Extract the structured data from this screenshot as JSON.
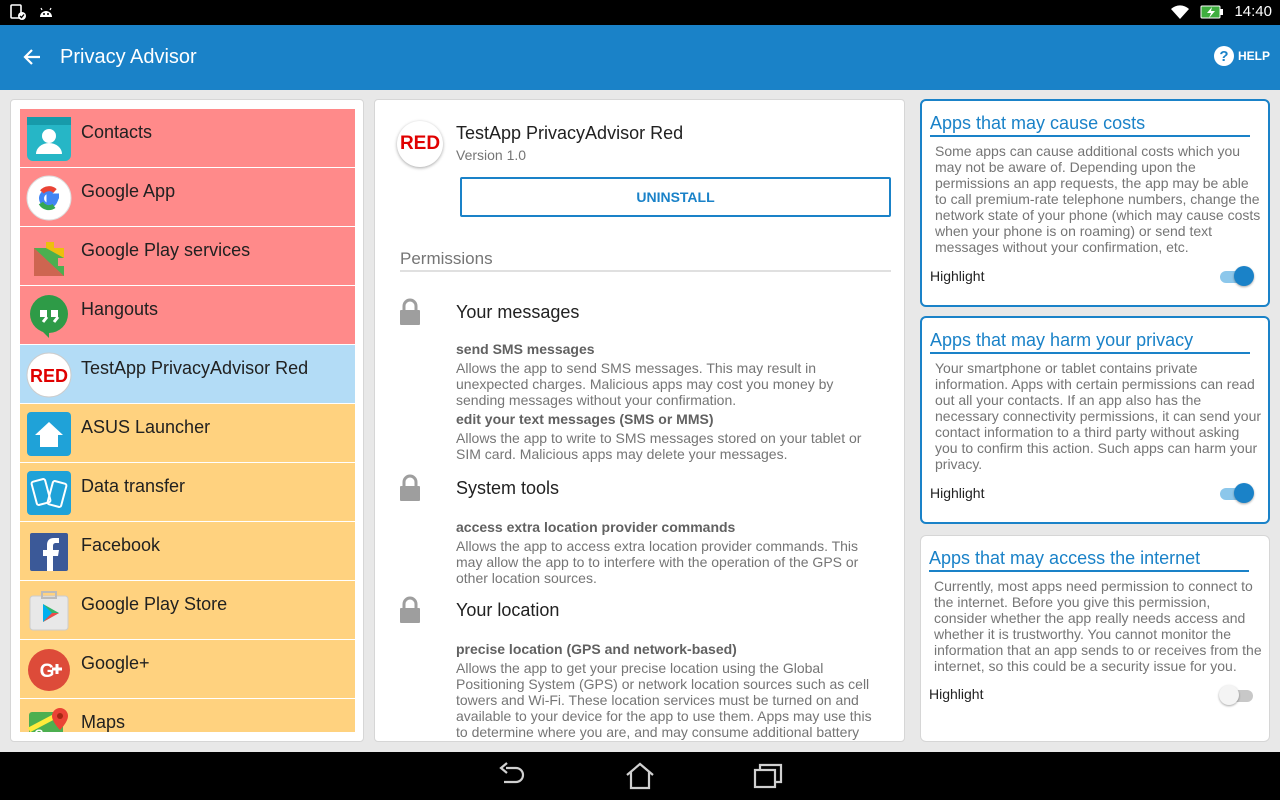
{
  "status_bar": {
    "time": "14:40"
  },
  "app_bar": {
    "title": "Privacy Advisor",
    "help_label": "HELP"
  },
  "apps": [
    {
      "name": "Contacts",
      "bg": "#ff8a8a",
      "icon": "contacts-icon"
    },
    {
      "name": "Google App",
      "bg": "#ff8a8a",
      "icon": "google-app-icon"
    },
    {
      "name": "Google Play services",
      "bg": "#ff8a8a",
      "icon": "google-play-services-icon"
    },
    {
      "name": "Hangouts",
      "bg": "#ff8a8a",
      "icon": "hangouts-icon"
    },
    {
      "name": "TestApp PrivacyAdvisor Red",
      "bg": "#b3dcf6",
      "icon": "red-badge-icon",
      "badge": "RED"
    },
    {
      "name": "ASUS Launcher",
      "bg": "#ffd27f",
      "icon": "asus-launcher-icon"
    },
    {
      "name": "Data transfer",
      "bg": "#ffd27f",
      "icon": "data-transfer-icon"
    },
    {
      "name": "Facebook",
      "bg": "#ffd27f",
      "icon": "facebook-icon"
    },
    {
      "name": "Google Play Store",
      "bg": "#ffd27f",
      "icon": "google-play-store-icon"
    },
    {
      "name": "Google+",
      "bg": "#ffd27f",
      "icon": "google-plus-icon"
    },
    {
      "name": "Maps",
      "bg": "#ffd27f",
      "icon": "maps-icon"
    }
  ],
  "detail": {
    "badge": "RED",
    "app_name": "TestApp PrivacyAdvisor Red",
    "version": "Version 1.0",
    "uninstall_label": "UNINSTALL",
    "permissions_header": "Permissions",
    "groups": [
      {
        "title": "Your messages",
        "perms": [
          {
            "name": "send SMS messages",
            "desc": "Allows the app to send SMS messages. This may result in unexpected charges. Malicious apps may cost you money by sending messages without your confirmation."
          },
          {
            "name": "edit your text messages (SMS or MMS)",
            "desc": "Allows the app to write to SMS messages stored on your tablet or SIM card. Malicious apps may delete your messages."
          }
        ]
      },
      {
        "title": "System tools",
        "perms": [
          {
            "name": "access extra location provider commands",
            "desc": "Allows the app to access extra location provider commands. This may allow the app to to interfere with the operation of the GPS or other location sources."
          }
        ]
      },
      {
        "title": "Your location",
        "perms": [
          {
            "name": "precise location (GPS and network-based)",
            "desc": "Allows the app to get your precise location using the Global Positioning System (GPS) or network location sources such as cell towers and Wi-Fi. These location services must be turned on and available to your device for the app to use them. Apps may use this to determine where you are, and may consume additional battery"
          }
        ]
      }
    ]
  },
  "cards": [
    {
      "title": "Apps that may cause costs",
      "body": "Some apps can cause additional costs which you may not be aware of. Depending upon the permissions an app requests, the app may be able to call premium-rate telephone numbers, change the network state of your phone (which may cause costs when your phone is on roaming) or send text messages without your confirmation, etc.",
      "highlight_label": "Highlight",
      "highlight_on": true
    },
    {
      "title": "Apps that may harm your privacy",
      "body": "Your smartphone or tablet contains private information. Apps with certain permissions can read out all your contacts. If an app also has the necessary connectivity permissions, it can send your contact information to a third party without asking you to confirm this action. Such apps can harm your privacy.",
      "highlight_label": "Highlight",
      "highlight_on": true
    },
    {
      "title": "Apps that may access the internet",
      "body": "Currently, most apps need permission to connect to the internet. Before you give this permission, consider whether the app really needs access and whether it is trustworthy. You cannot monitor the information that an app sends to or receives from the internet, so this could be a security issue for you.",
      "highlight_label": "Highlight",
      "highlight_on": false
    }
  ],
  "colors": {
    "accent": "#1a82c8",
    "risk_high": "#ff8a8a",
    "risk_medium": "#ffd27f",
    "selected": "#b3dcf6"
  }
}
